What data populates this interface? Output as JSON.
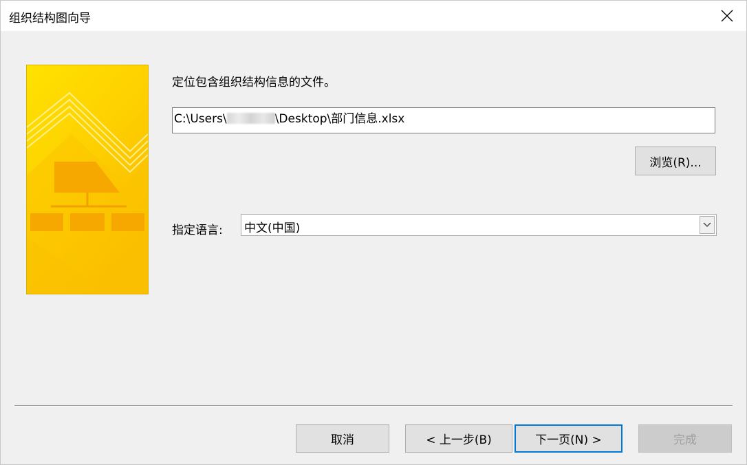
{
  "window": {
    "title": "组织结构图向导"
  },
  "instruction": "定位包含组织结构信息的文件。",
  "file_path": {
    "prefix": "C:\\Users\\",
    "suffix": "\\Desktop\\部门信息.xlsx"
  },
  "buttons": {
    "browse": "浏览(R)...",
    "cancel": "取消",
    "back": "< 上一步(B)",
    "next": "下一页(N) >",
    "finish": "完成"
  },
  "language": {
    "label": "指定语言:",
    "selected": "中文(中国)"
  },
  "icons": {
    "close": "close-icon",
    "dropdown": "chevron-down-icon",
    "banner": "org-chart-illustration"
  },
  "colors": {
    "accent": "#0078d7",
    "banner_yellow": "#fed500",
    "banner_orange": "#f7a800"
  }
}
